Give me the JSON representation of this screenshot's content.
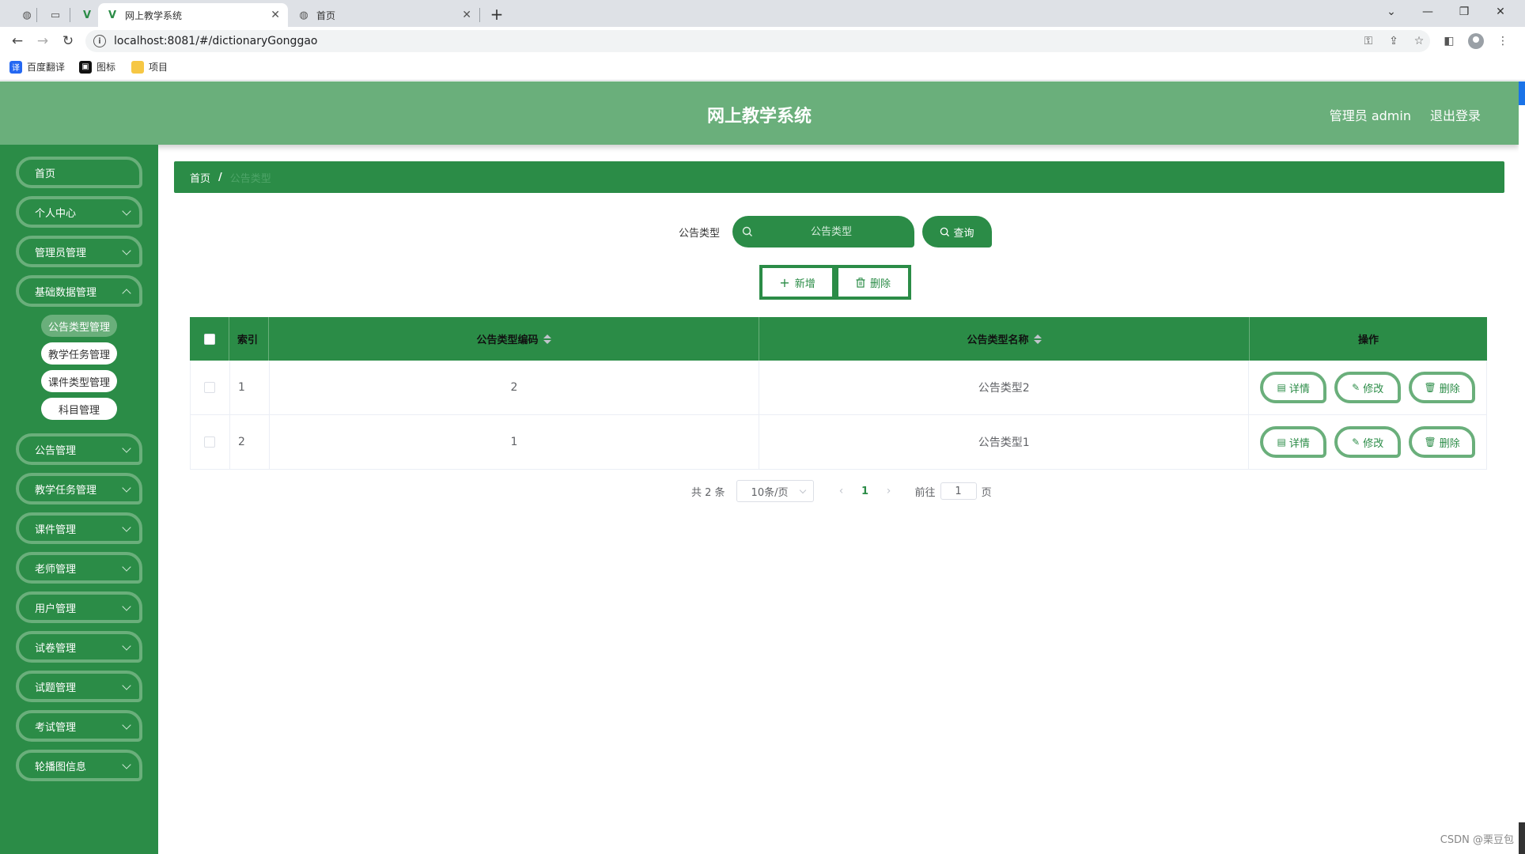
{
  "browser": {
    "tabs": [
      {
        "title": "网上教学系统",
        "active": true
      },
      {
        "title": "首页",
        "active": false
      }
    ],
    "url": "localhost:8081/#/dictionaryGonggao",
    "bookmarks": [
      "百度翻译",
      "图标",
      "项目"
    ]
  },
  "header": {
    "title": "网上教学系统",
    "user": "管理员 admin",
    "logout": "退出登录"
  },
  "sidebar": {
    "items": [
      {
        "label": "首页",
        "has_children": false
      },
      {
        "label": "个人中心",
        "has_children": true
      },
      {
        "label": "管理员管理",
        "has_children": true
      },
      {
        "label": "基础数据管理",
        "has_children": true
      }
    ],
    "sub_items": [
      {
        "label": "公告类型管理",
        "active": true
      },
      {
        "label": "教学任务管理",
        "active": false
      },
      {
        "label": "课件类型管理",
        "active": false
      },
      {
        "label": "科目管理",
        "active": false
      }
    ],
    "items_after": [
      {
        "label": "公告管理"
      },
      {
        "label": "教学任务管理"
      },
      {
        "label": "课件管理"
      },
      {
        "label": "老师管理"
      },
      {
        "label": "用户管理"
      },
      {
        "label": "试卷管理"
      },
      {
        "label": "试题管理"
      },
      {
        "label": "考试管理"
      },
      {
        "label": "轮播图信息"
      }
    ]
  },
  "breadcrumb": {
    "home": "首页",
    "separator": "/",
    "current": "公告类型"
  },
  "search": {
    "label": "公告类型",
    "placeholder": "公告类型",
    "button": "查询"
  },
  "actions": {
    "add": "新增",
    "delete": "删除"
  },
  "table": {
    "columns": [
      "索引",
      "公告类型编码",
      "公告类型名称",
      "操作"
    ],
    "rows": [
      {
        "index": "1",
        "code": "2",
        "name": "公告类型2"
      },
      {
        "index": "2",
        "code": "1",
        "name": "公告类型1"
      }
    ],
    "row_actions": {
      "detail": "详情",
      "edit": "修改",
      "delete": "删除"
    }
  },
  "pagination": {
    "total": "共 2 条",
    "page_size": "10条/页",
    "current_page": "1",
    "goto_prefix": "前往",
    "goto_value": "1",
    "goto_suffix": "页"
  },
  "watermark": "CSDN @栗豆包",
  "colors": {
    "primary": "#2b8c47",
    "header": "#6aaf7b",
    "border_accent": "#6aaf7b"
  }
}
